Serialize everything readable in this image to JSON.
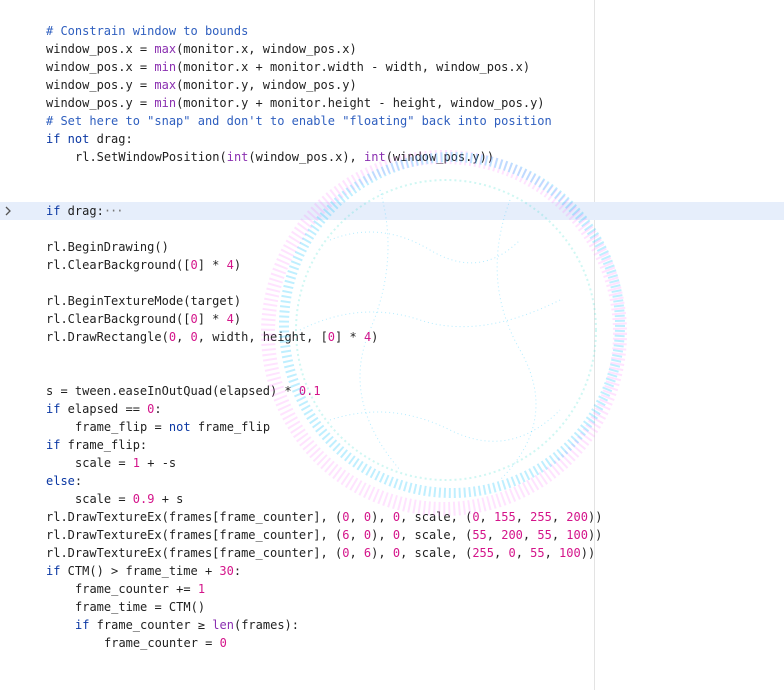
{
  "editor": {
    "lines": [
      {
        "indent": 0,
        "tokens": [
          {
            "c": "cm",
            "t": "# Constrain window to bounds"
          }
        ]
      },
      {
        "indent": 0,
        "tokens": [
          {
            "c": "",
            "t": "window_pos.x = "
          },
          {
            "c": "fn",
            "t": "max"
          },
          {
            "c": "",
            "t": "(monitor.x, window_pos.x)"
          }
        ]
      },
      {
        "indent": 0,
        "tokens": [
          {
            "c": "",
            "t": "window_pos.x = "
          },
          {
            "c": "fn",
            "t": "min"
          },
          {
            "c": "",
            "t": "(monitor.x + monitor.width - width, window_pos.x)"
          }
        ]
      },
      {
        "indent": 0,
        "tokens": [
          {
            "c": "",
            "t": "window_pos.y = "
          },
          {
            "c": "fn",
            "t": "max"
          },
          {
            "c": "",
            "t": "(monitor.y, window_pos.y)"
          }
        ]
      },
      {
        "indent": 0,
        "tokens": [
          {
            "c": "",
            "t": "window_pos.y = "
          },
          {
            "c": "fn",
            "t": "min"
          },
          {
            "c": "",
            "t": "(monitor.y + monitor.height - height, window_pos.y)"
          }
        ]
      },
      {
        "indent": 0,
        "tokens": [
          {
            "c": "cm",
            "t": "# Set here to \"snap\" and don't to enable \"floating\" back into position"
          }
        ]
      },
      {
        "indent": 0,
        "tokens": [
          {
            "c": "kw",
            "t": "if not"
          },
          {
            "c": "",
            "t": " drag:"
          }
        ]
      },
      {
        "indent": 1,
        "tokens": [
          {
            "c": "",
            "t": "rl.SetWindowPosition("
          },
          {
            "c": "fn",
            "t": "int"
          },
          {
            "c": "",
            "t": "(window_pos.x), "
          },
          {
            "c": "fn",
            "t": "int"
          },
          {
            "c": "",
            "t": "(window_pos.y))"
          }
        ]
      },
      {
        "indent": 0,
        "tokens": []
      },
      {
        "indent": 0,
        "tokens": []
      },
      {
        "indent": 0,
        "highlight": true,
        "folded": true,
        "tokens": [
          {
            "c": "kw",
            "t": "if"
          },
          {
            "c": "",
            "t": " drag:"
          },
          {
            "c": "dots",
            "t": "···"
          }
        ]
      },
      {
        "indent": 0,
        "tokens": []
      },
      {
        "indent": 0,
        "tokens": [
          {
            "c": "",
            "t": "rl.BeginDrawing()"
          }
        ]
      },
      {
        "indent": 0,
        "tokens": [
          {
            "c": "",
            "t": "rl.ClearBackground(["
          },
          {
            "c": "nm",
            "t": "0"
          },
          {
            "c": "",
            "t": "] * "
          },
          {
            "c": "nm",
            "t": "4"
          },
          {
            "c": "",
            "t": ")"
          }
        ]
      },
      {
        "indent": 0,
        "tokens": []
      },
      {
        "indent": 0,
        "tokens": [
          {
            "c": "",
            "t": "rl.BeginTextureMode(target)"
          }
        ]
      },
      {
        "indent": 0,
        "tokens": [
          {
            "c": "",
            "t": "rl.ClearBackground(["
          },
          {
            "c": "nm",
            "t": "0"
          },
          {
            "c": "",
            "t": "] * "
          },
          {
            "c": "nm",
            "t": "4"
          },
          {
            "c": "",
            "t": ")"
          }
        ]
      },
      {
        "indent": 0,
        "tokens": [
          {
            "c": "",
            "t": "rl.DrawRectangle("
          },
          {
            "c": "nm",
            "t": "0"
          },
          {
            "c": "",
            "t": ", "
          },
          {
            "c": "nm",
            "t": "0"
          },
          {
            "c": "",
            "t": ", width, height, ["
          },
          {
            "c": "nm",
            "t": "0"
          },
          {
            "c": "",
            "t": "] * "
          },
          {
            "c": "nm",
            "t": "4"
          },
          {
            "c": "",
            "t": ")"
          }
        ]
      },
      {
        "indent": 0,
        "tokens": []
      },
      {
        "indent": 0,
        "tokens": []
      },
      {
        "indent": 0,
        "tokens": [
          {
            "c": "",
            "t": "s = tween.easeInOutQuad(elapsed) * "
          },
          {
            "c": "nm",
            "t": "0.1"
          }
        ]
      },
      {
        "indent": 0,
        "tokens": [
          {
            "c": "kw",
            "t": "if"
          },
          {
            "c": "",
            "t": " elapsed == "
          },
          {
            "c": "nm",
            "t": "0"
          },
          {
            "c": "",
            "t": ":"
          }
        ]
      },
      {
        "indent": 1,
        "tokens": [
          {
            "c": "",
            "t": "frame_flip = "
          },
          {
            "c": "kw",
            "t": "not"
          },
          {
            "c": "",
            "t": " frame_flip"
          }
        ]
      },
      {
        "indent": 0,
        "tokens": [
          {
            "c": "kw",
            "t": "if"
          },
          {
            "c": "",
            "t": " frame_flip:"
          }
        ]
      },
      {
        "indent": 1,
        "tokens": [
          {
            "c": "",
            "t": "scale = "
          },
          {
            "c": "nm",
            "t": "1"
          },
          {
            "c": "",
            "t": " + -s"
          }
        ]
      },
      {
        "indent": 0,
        "tokens": [
          {
            "c": "kw",
            "t": "else"
          },
          {
            "c": "",
            "t": ":"
          }
        ]
      },
      {
        "indent": 1,
        "tokens": [
          {
            "c": "",
            "t": "scale = "
          },
          {
            "c": "nm",
            "t": "0.9"
          },
          {
            "c": "",
            "t": " + s"
          }
        ]
      },
      {
        "indent": 0,
        "tokens": [
          {
            "c": "",
            "t": "rl.DrawTextureEx(frames[frame_counter], ("
          },
          {
            "c": "nm",
            "t": "0"
          },
          {
            "c": "",
            "t": ", "
          },
          {
            "c": "nm",
            "t": "0"
          },
          {
            "c": "",
            "t": "), "
          },
          {
            "c": "nm",
            "t": "0"
          },
          {
            "c": "",
            "t": ", scale, ("
          },
          {
            "c": "nm",
            "t": "0"
          },
          {
            "c": "",
            "t": ", "
          },
          {
            "c": "nm",
            "t": "155"
          },
          {
            "c": "",
            "t": ", "
          },
          {
            "c": "nm",
            "t": "255"
          },
          {
            "c": "",
            "t": ", "
          },
          {
            "c": "nm",
            "t": "200"
          },
          {
            "c": "",
            "t": "))"
          }
        ]
      },
      {
        "indent": 0,
        "tokens": [
          {
            "c": "",
            "t": "rl.DrawTextureEx(frames[frame_counter], ("
          },
          {
            "c": "nm",
            "t": "6"
          },
          {
            "c": "",
            "t": ", "
          },
          {
            "c": "nm",
            "t": "0"
          },
          {
            "c": "",
            "t": "), "
          },
          {
            "c": "nm",
            "t": "0"
          },
          {
            "c": "",
            "t": ", scale, ("
          },
          {
            "c": "nm",
            "t": "55"
          },
          {
            "c": "",
            "t": ", "
          },
          {
            "c": "nm",
            "t": "200"
          },
          {
            "c": "",
            "t": ", "
          },
          {
            "c": "nm",
            "t": "55"
          },
          {
            "c": "",
            "t": ", "
          },
          {
            "c": "nm",
            "t": "100"
          },
          {
            "c": "",
            "t": "))"
          }
        ]
      },
      {
        "indent": 0,
        "tokens": [
          {
            "c": "",
            "t": "rl.DrawTextureEx(frames[frame_counter], ("
          },
          {
            "c": "nm",
            "t": "0"
          },
          {
            "c": "",
            "t": ", "
          },
          {
            "c": "nm",
            "t": "6"
          },
          {
            "c": "",
            "t": "), "
          },
          {
            "c": "nm",
            "t": "0"
          },
          {
            "c": "",
            "t": ", scale, ("
          },
          {
            "c": "nm",
            "t": "255"
          },
          {
            "c": "",
            "t": ", "
          },
          {
            "c": "nm",
            "t": "0"
          },
          {
            "c": "",
            "t": ", "
          },
          {
            "c": "nm",
            "t": "55"
          },
          {
            "c": "",
            "t": ", "
          },
          {
            "c": "nm",
            "t": "100"
          },
          {
            "c": "",
            "t": "))"
          }
        ]
      },
      {
        "indent": 0,
        "tokens": [
          {
            "c": "kw",
            "t": "if"
          },
          {
            "c": "",
            "t": " CTM() > frame_time + "
          },
          {
            "c": "nm",
            "t": "30"
          },
          {
            "c": "",
            "t": ":"
          }
        ]
      },
      {
        "indent": 1,
        "tokens": [
          {
            "c": "",
            "t": "frame_counter += "
          },
          {
            "c": "nm",
            "t": "1"
          }
        ]
      },
      {
        "indent": 1,
        "tokens": [
          {
            "c": "",
            "t": "frame_time = CTM()"
          }
        ]
      },
      {
        "indent": 1,
        "tokens": [
          {
            "c": "kw",
            "t": "if"
          },
          {
            "c": "",
            "t": " frame_counter ≥ "
          },
          {
            "c": "fn",
            "t": "len"
          },
          {
            "c": "",
            "t": "(frames):"
          }
        ]
      },
      {
        "indent": 2,
        "tokens": [
          {
            "c": "",
            "t": "frame_counter = "
          },
          {
            "c": "nm",
            "t": "0"
          }
        ]
      }
    ]
  },
  "overlay": {
    "description_colors": {
      "cyan": "#00bfff",
      "magenta": "#ff64ff",
      "teal": "#40e0d0"
    }
  },
  "fold_icon": "chevron-right-icon"
}
